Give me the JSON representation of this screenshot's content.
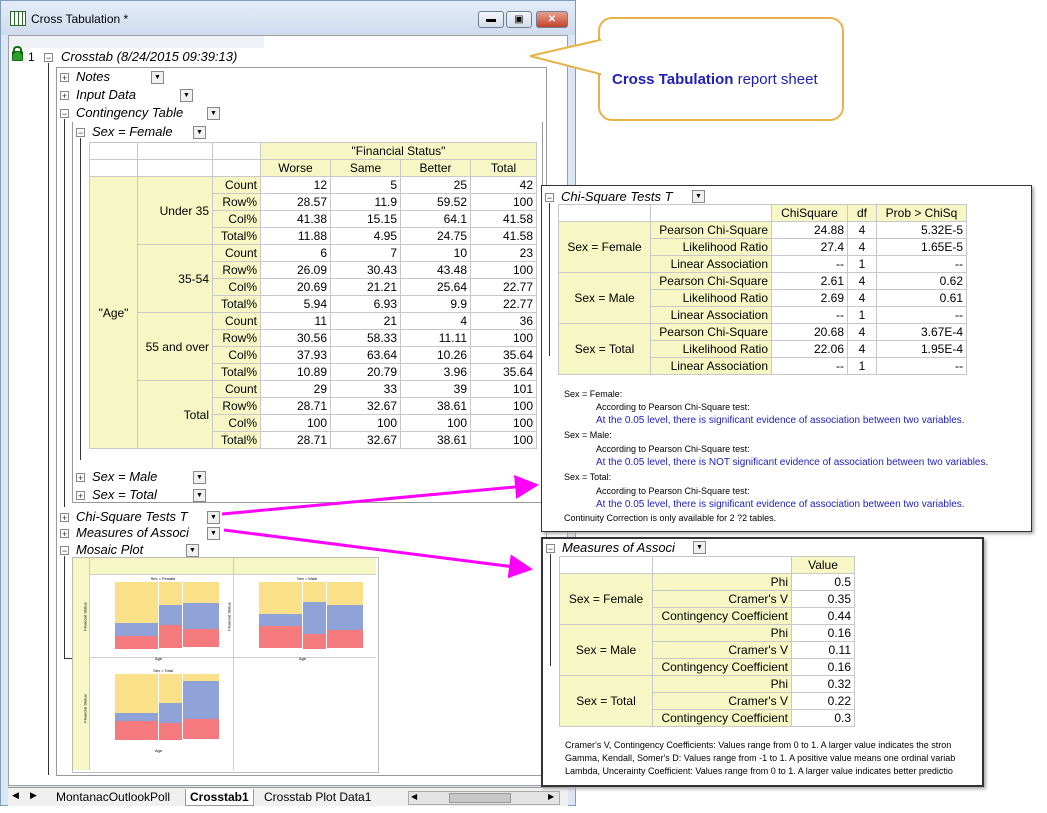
{
  "window": {
    "title": "Cross Tabulation *",
    "min": "▬",
    "max": "▣",
    "close": "✕"
  },
  "tree": {
    "row_number": "1",
    "root": "Crosstab (8/24/2015 09:39:13)",
    "notes": "Notes",
    "input_data": "Input Data",
    "contingency": "Contingency Table",
    "sex_female": "Sex = Female",
    "sex_male": "Sex = Male",
    "sex_total": "Sex = Total",
    "chi_square": "Chi-Square Tests T",
    "measures": "Measures of Associ",
    "mosaic": "Mosaic Plot"
  },
  "contingency": {
    "col_group": "\"Financial Status\"",
    "columns": [
      "Worse",
      "Same",
      "Better",
      "Total"
    ],
    "row_group": "\"Age\"",
    "stats": [
      "Count",
      "Row%",
      "Col%",
      "Total%"
    ],
    "groups": [
      {
        "name": "Under 35",
        "rows": [
          [
            "12",
            "5",
            "25",
            "42"
          ],
          [
            "28.57",
            "11.9",
            "59.52",
            "100"
          ],
          [
            "41.38",
            "15.15",
            "64.1",
            "41.58"
          ],
          [
            "11.88",
            "4.95",
            "24.75",
            "41.58"
          ]
        ]
      },
      {
        "name": "35-54",
        "rows": [
          [
            "6",
            "7",
            "10",
            "23"
          ],
          [
            "26.09",
            "30.43",
            "43.48",
            "100"
          ],
          [
            "20.69",
            "21.21",
            "25.64",
            "22.77"
          ],
          [
            "5.94",
            "6.93",
            "9.9",
            "22.77"
          ]
        ]
      },
      {
        "name": "55 and over",
        "rows": [
          [
            "11",
            "21",
            "4",
            "36"
          ],
          [
            "30.56",
            "58.33",
            "11.11",
            "100"
          ],
          [
            "37.93",
            "63.64",
            "10.26",
            "35.64"
          ],
          [
            "10.89",
            "20.79",
            "3.96",
            "35.64"
          ]
        ]
      },
      {
        "name": "Total",
        "rows": [
          [
            "29",
            "33",
            "39",
            "101"
          ],
          [
            "28.71",
            "32.67",
            "38.61",
            "100"
          ],
          [
            "100",
            "100",
            "100",
            "100"
          ],
          [
            "28.71",
            "32.67",
            "38.61",
            "100"
          ]
        ]
      }
    ]
  },
  "callout": {
    "bold": "Cross Tabulation",
    "rest": " report sheet"
  },
  "chi": {
    "title": "Chi-Square Tests T",
    "headers": [
      "ChiSquare",
      "df",
      "Prob > ChiSq"
    ],
    "groups": [
      {
        "name": "Sex = Female",
        "rows": [
          [
            "Pearson Chi-Square",
            "24.88",
            "4",
            "5.32E-5"
          ],
          [
            "Likelihood Ratio",
            "27.4",
            "4",
            "1.65E-5"
          ],
          [
            "Linear Association",
            "--",
            "1",
            "--"
          ]
        ]
      },
      {
        "name": "Sex = Male",
        "rows": [
          [
            "Pearson Chi-Square",
            "2.61",
            "4",
            "0.62"
          ],
          [
            "Likelihood Ratio",
            "2.69",
            "4",
            "0.61"
          ],
          [
            "Linear Association",
            "--",
            "1",
            "--"
          ]
        ]
      },
      {
        "name": "Sex = Total",
        "rows": [
          [
            "Pearson Chi-Square",
            "20.68",
            "4",
            "3.67E-4"
          ],
          [
            "Likelihood Ratio",
            "22.06",
            "4",
            "1.95E-4"
          ],
          [
            "Linear Association",
            "--",
            "1",
            "--"
          ]
        ]
      }
    ],
    "notes": [
      "Sex = Female:",
      "According to Pearson Chi-Square test:",
      "At the 0.05 level, there is significant evidence of association between two variables.",
      "Sex = Male:",
      "According to Pearson Chi-Square test:",
      "At the 0.05 level, there is NOT significant evidence of association between two variables.",
      "Sex = Total:",
      "According to Pearson Chi-Square test:",
      "At the 0.05 level, there is significant evidence of association between two variables.",
      "Continuity Correction is only available for 2 ?2 tables."
    ]
  },
  "measures": {
    "title": "Measures of Associ",
    "header": "Value",
    "groups": [
      {
        "name": "Sex = Female",
        "rows": [
          [
            "Phi",
            "0.5"
          ],
          [
            "Cramer's V",
            "0.35"
          ],
          [
            "Contingency Coefficient",
            "0.44"
          ]
        ]
      },
      {
        "name": "Sex = Male",
        "rows": [
          [
            "Phi",
            "0.16"
          ],
          [
            "Cramer's V",
            "0.11"
          ],
          [
            "Contingency Coefficient",
            "0.16"
          ]
        ]
      },
      {
        "name": "Sex = Total",
        "rows": [
          [
            "Phi",
            "0.32"
          ],
          [
            "Cramer's V",
            "0.22"
          ],
          [
            "Contingency Coefficient",
            "0.3"
          ]
        ]
      }
    ],
    "notes": [
      "Cramer's V, Contingency Coefficients: Values range from 0 to 1. A larger value indicates the stron",
      "Gamma, Kendall, Somer's D: Values range from -1 to 1. A positive value means one ordinal variab",
      "Lambda, Uncerainty Coefficient: Values range from 0 to 1. A larger value indicates better predictio"
    ]
  },
  "mosaic": {
    "titles": [
      "Sex = Female",
      "Sex = Male",
      "Sex = Total"
    ],
    "ylabel": "Financial Status",
    "xlabel": "Age",
    "colors": {
      "worse": "#f47a7e",
      "same": "#8fa3d8",
      "better": "#fbe08a"
    }
  },
  "tabs": [
    "MontanacOutlookPoll",
    "Crosstab1",
    "Crosstab Plot Data1"
  ],
  "colors": {
    "accent_arrow": "#ff00ff",
    "callout_blue": "#1f1fb8",
    "callout_border": "#e8b24a"
  }
}
